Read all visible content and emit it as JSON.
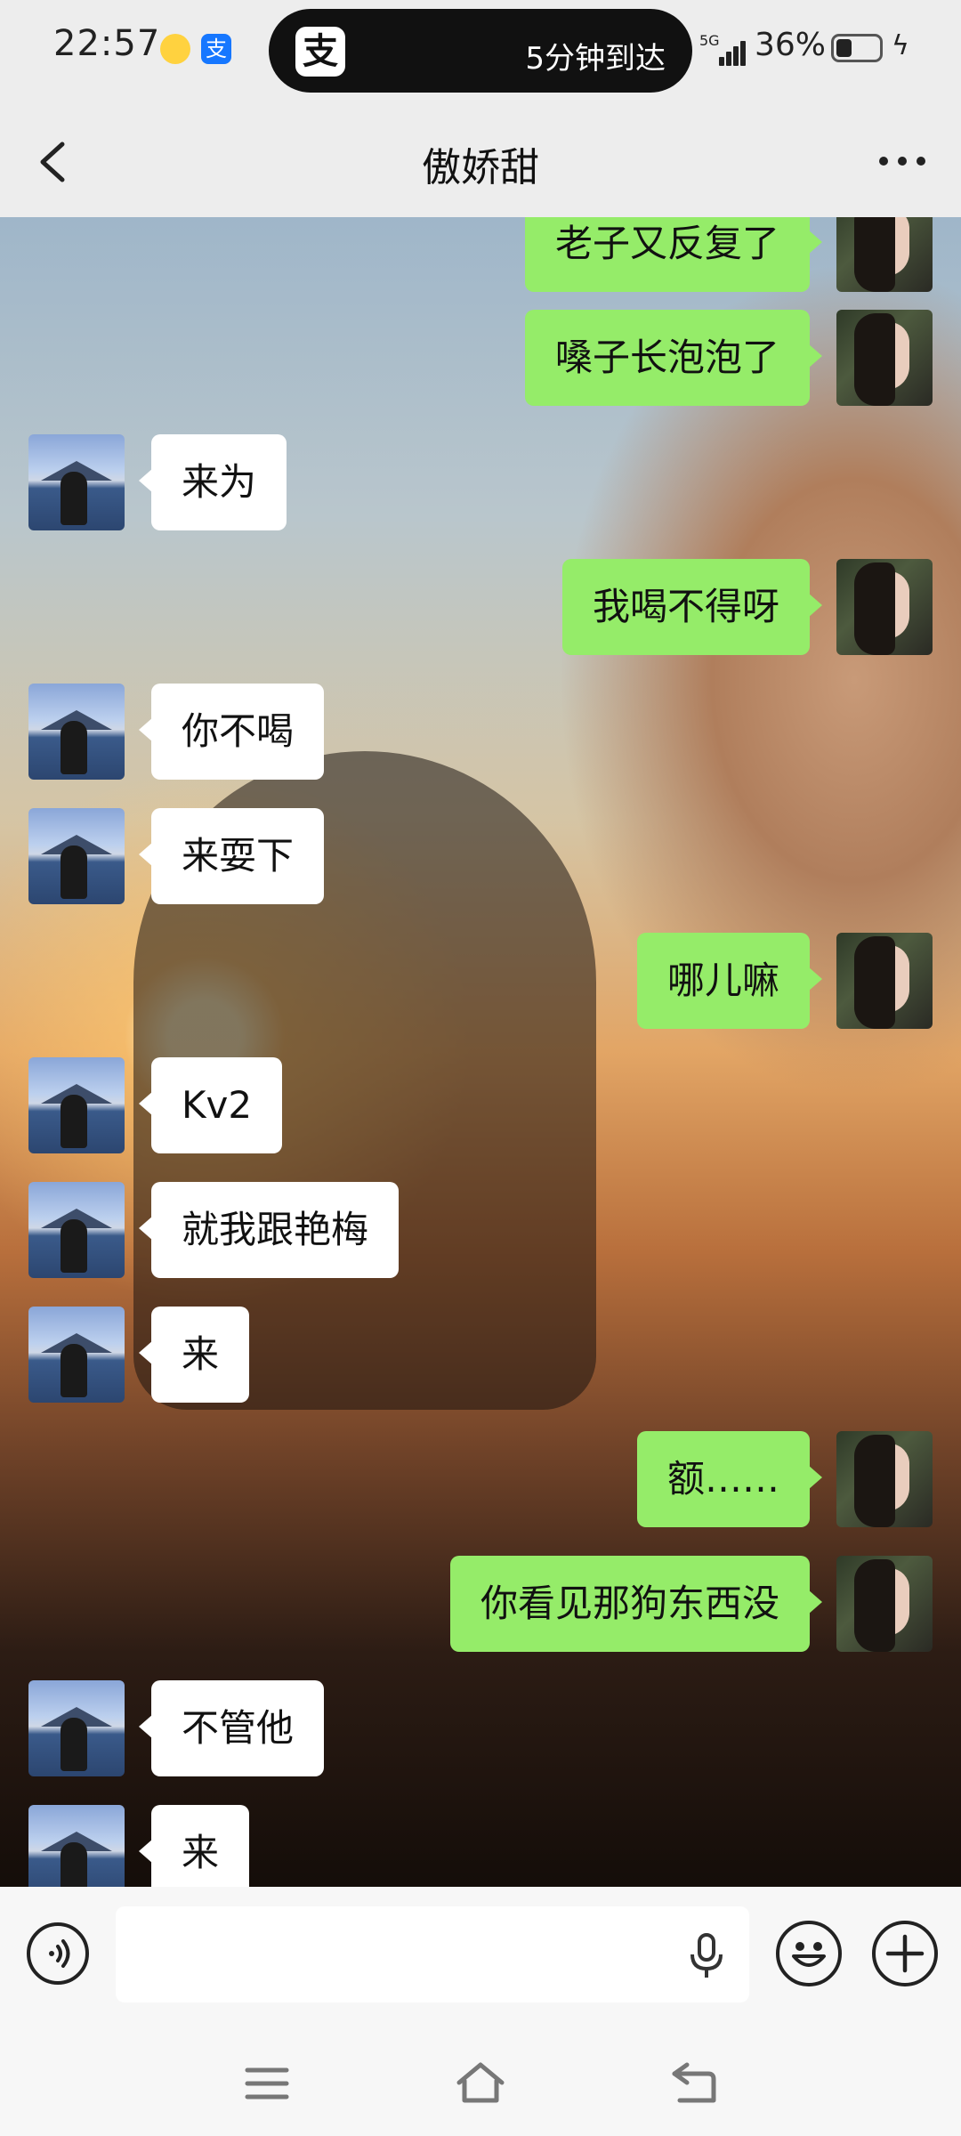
{
  "status_bar": {
    "time": "22:57",
    "island_app_icon": "alipay-icon",
    "island_app_glyph": "支",
    "island_text": "5分钟到达",
    "small_icon_2_glyph": "支",
    "network": "5G",
    "battery": "36%",
    "battery_level": 0.36
  },
  "header": {
    "title": "傲娇甜",
    "back_icon": "chevron-left-icon",
    "more_icon": "more-dots-icon"
  },
  "messages": [
    {
      "side": "right",
      "text": "老子又反复了"
    },
    {
      "side": "right",
      "text": "嗓子长泡泡了"
    },
    {
      "side": "left",
      "text": "来为"
    },
    {
      "side": "right",
      "text": "我喝不得呀"
    },
    {
      "side": "left",
      "text": "你不喝"
    },
    {
      "side": "left",
      "text": "来耍下"
    },
    {
      "side": "right",
      "text": "哪儿嘛"
    },
    {
      "side": "left",
      "text": "Kv2"
    },
    {
      "side": "left",
      "text": "就我跟艳梅"
    },
    {
      "side": "left",
      "text": "来"
    },
    {
      "side": "right",
      "text": "额……"
    },
    {
      "side": "right",
      "text": "你看见那狗东西没"
    },
    {
      "side": "left",
      "text": "不管他"
    },
    {
      "side": "left",
      "text": "来"
    }
  ],
  "input_bar": {
    "placeholder": "",
    "voice_icon": "voice-icon",
    "mic_icon": "microphone-icon",
    "emoji_icon": "emoji-icon",
    "plus_icon": "plus-icon"
  },
  "nav_bar": {
    "menu_icon": "menu-icon",
    "home_icon": "home-icon",
    "back_icon": "back-icon"
  },
  "colors": {
    "sent_bubble": "#95ec69",
    "received_bubble": "#ffffff",
    "header_bg": "#ededed"
  }
}
